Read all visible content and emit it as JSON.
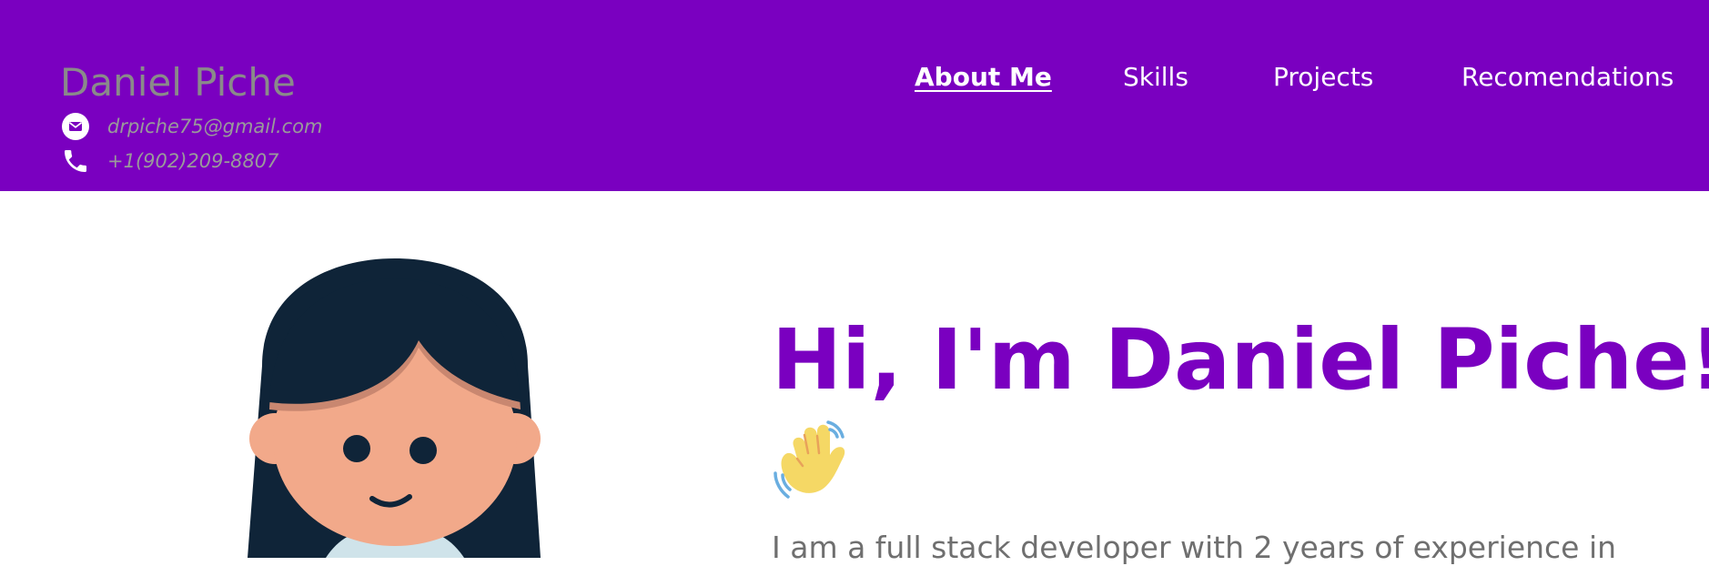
{
  "header": {
    "name": "Daniel Piche",
    "email": "drpiche75@gmail.com",
    "phone": "+1(902)209-8807",
    "email_icon": "email-icon",
    "phone_icon": "phone-icon"
  },
  "nav": {
    "items": [
      {
        "label": "About Me",
        "active": true
      },
      {
        "label": "Skills",
        "active": false
      },
      {
        "label": "Projects",
        "active": false
      },
      {
        "label": "Recomendations",
        "active": false
      }
    ]
  },
  "hero": {
    "title": "Hi, I'm Daniel Piche!",
    "emoji": "waving-hand-icon",
    "intro": "I am a full stack developer with 2 years of experience in"
  },
  "colors": {
    "accent": "#7a00c0",
    "header_text": "#8a8a8a",
    "nav_text": "#ffffff",
    "body_text": "#6f6f6f"
  }
}
